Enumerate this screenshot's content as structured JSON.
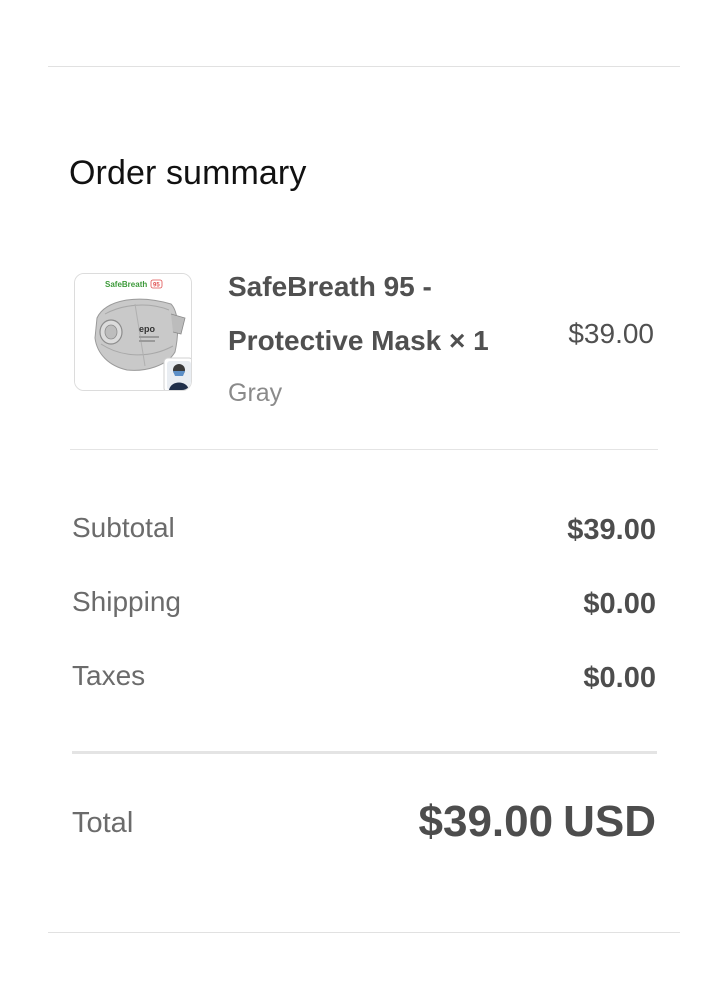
{
  "order_summary": {
    "title": "Order summary",
    "product": {
      "name_line1": "SafeBreath 95 -",
      "name_line2": "Protective Mask × 1",
      "variant": "Gray",
      "price": "$39.00",
      "image": {
        "brand_text": "SafeBreath",
        "badge_text": "95",
        "mask_text": "epo"
      }
    },
    "lines": [
      {
        "label": "Subtotal",
        "value": "$39.00"
      },
      {
        "label": "Shipping",
        "value": "$0.00"
      },
      {
        "label": "Taxes",
        "value": "$0.00"
      }
    ],
    "total": {
      "label": "Total",
      "amount": "$39.00",
      "currency": "USD"
    }
  },
  "colors": {
    "brand_green": "#3d9a3a",
    "badge_red": "#e05050",
    "text_dark": "#4d4d4d",
    "text_muted": "#6b6b6b"
  }
}
